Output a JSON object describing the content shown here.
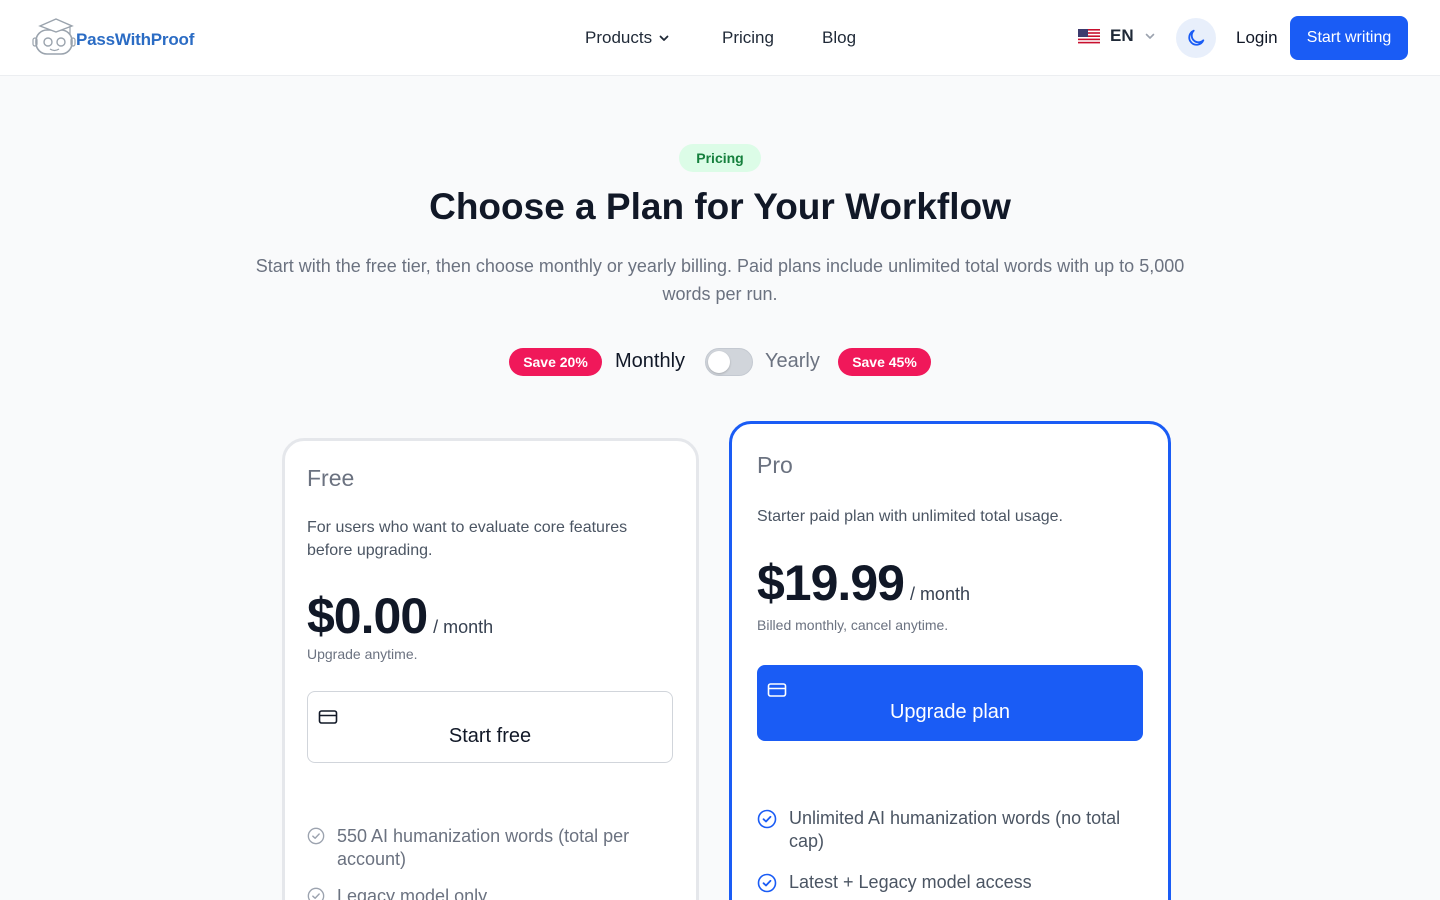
{
  "header": {
    "logo_text": "PassWithProof",
    "nav": {
      "products": "Products",
      "pricing": "Pricing",
      "blog": "Blog"
    },
    "language": "EN",
    "login": "Login",
    "start_writing": "Start writing"
  },
  "hero": {
    "badge": "Pricing",
    "title": "Choose a Plan for Your Workflow",
    "subtitle": "Start with the free tier, then choose monthly or yearly billing. Paid plans include unlimited total words with up to 5,000 words per run."
  },
  "billing": {
    "save_monthly": "Save 20%",
    "monthly_label": "Monthly",
    "yearly_label": "Yearly",
    "save_yearly": "Save 45%",
    "selected": "Monthly"
  },
  "plans": [
    {
      "name": "Free",
      "description": "For users who want to evaluate core features before upgrading.",
      "price": "$0.00",
      "period": "/ month",
      "note": "Upgrade anytime.",
      "cta": "Start free",
      "features": [
        "550 AI humanization words (total per account)",
        "Legacy model only"
      ]
    },
    {
      "name": "Pro",
      "description": "Starter paid plan with unlimited total usage.",
      "price": "$19.99",
      "period": "/ month",
      "note": "Billed monthly, cancel anytime.",
      "cta": "Upgrade plan",
      "features": [
        "Unlimited AI humanization words (no total cap)",
        "Latest + Legacy model access"
      ]
    }
  ],
  "colors": {
    "primary": "#1a5cf5",
    "save_badge": "#f0185a",
    "pricing_badge_bg": "#dcfce7",
    "pricing_badge_text": "#15803d"
  },
  "icons": {
    "logo": "robot-graduation-cap-icon",
    "theme": "moon-icon",
    "cta": "credit-card-icon",
    "feature": "check-circle-icon",
    "dropdown": "chevron-down-icon"
  }
}
